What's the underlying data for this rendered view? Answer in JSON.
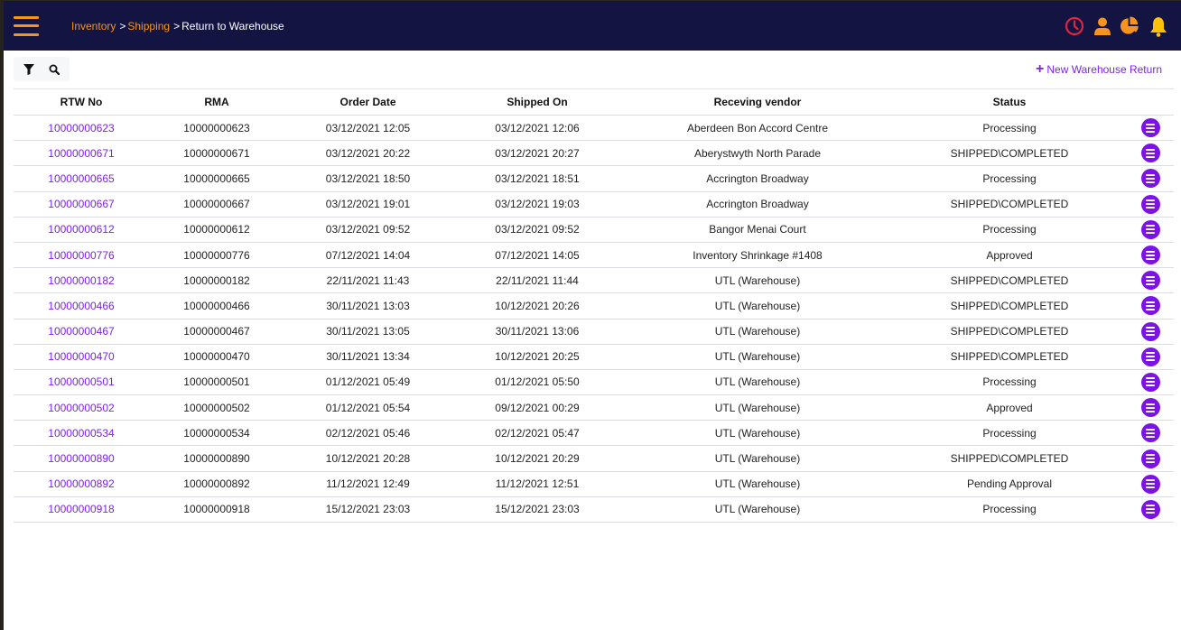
{
  "header": {
    "breadcrumb": [
      {
        "label": "Inventory",
        "link": true
      },
      {
        "label": "Shipping",
        "link": true
      },
      {
        "label": "Return to Warehouse",
        "link": false
      }
    ],
    "separator": ">",
    "icons": [
      "clock-icon",
      "user-icon",
      "pie-chart-icon",
      "bell-icon"
    ],
    "colors": {
      "bar": "#141443",
      "accent": "#f7941d",
      "clock": "#e0263c",
      "bell": "#ffc107"
    }
  },
  "toolbar": {
    "filter_icon": "filter-icon",
    "search_icon": "search-icon",
    "new_button_label": "New Warehouse Return"
  },
  "table": {
    "columns": [
      "RTW No",
      "RMA",
      "Order Date",
      "Shipped On",
      "Receving vendor",
      "Status",
      ""
    ],
    "rows": [
      {
        "rtw": "10000000623",
        "rma": "10000000623",
        "order_date": "03/12/2021 12:05",
        "shipped_on": "03/12/2021 12:06",
        "vendor": "Aberdeen Bon Accord Centre",
        "status": "Processing"
      },
      {
        "rtw": "10000000671",
        "rma": "10000000671",
        "order_date": "03/12/2021 20:22",
        "shipped_on": "03/12/2021 20:27",
        "vendor": "Aberystwyth North Parade",
        "status": "SHIPPED\\COMPLETED"
      },
      {
        "rtw": "10000000665",
        "rma": "10000000665",
        "order_date": "03/12/2021 18:50",
        "shipped_on": "03/12/2021 18:51",
        "vendor": "Accrington Broadway",
        "status": "Processing"
      },
      {
        "rtw": "10000000667",
        "rma": "10000000667",
        "order_date": "03/12/2021 19:01",
        "shipped_on": "03/12/2021 19:03",
        "vendor": "Accrington Broadway",
        "status": "SHIPPED\\COMPLETED"
      },
      {
        "rtw": "10000000612",
        "rma": "10000000612",
        "order_date": "03/12/2021 09:52",
        "shipped_on": "03/12/2021 09:52",
        "vendor": "Bangor Menai Court",
        "status": "Processing"
      },
      {
        "rtw": "10000000776",
        "rma": "10000000776",
        "order_date": "07/12/2021 14:04",
        "shipped_on": "07/12/2021 14:05",
        "vendor": "Inventory Shrinkage #1408",
        "status": "Approved"
      },
      {
        "rtw": "10000000182",
        "rma": "10000000182",
        "order_date": "22/11/2021 11:43",
        "shipped_on": "22/11/2021 11:44",
        "vendor": "UTL (Warehouse)",
        "status": "SHIPPED\\COMPLETED"
      },
      {
        "rtw": "10000000466",
        "rma": "10000000466",
        "order_date": "30/11/2021 13:03",
        "shipped_on": "10/12/2021 20:26",
        "vendor": "UTL (Warehouse)",
        "status": "SHIPPED\\COMPLETED"
      },
      {
        "rtw": "10000000467",
        "rma": "10000000467",
        "order_date": "30/11/2021 13:05",
        "shipped_on": "30/11/2021 13:06",
        "vendor": "UTL (Warehouse)",
        "status": "SHIPPED\\COMPLETED"
      },
      {
        "rtw": "10000000470",
        "rma": "10000000470",
        "order_date": "30/11/2021 13:34",
        "shipped_on": "10/12/2021 20:25",
        "vendor": "UTL (Warehouse)",
        "status": "SHIPPED\\COMPLETED"
      },
      {
        "rtw": "10000000501",
        "rma": "10000000501",
        "order_date": "01/12/2021 05:49",
        "shipped_on": "01/12/2021 05:50",
        "vendor": "UTL (Warehouse)",
        "status": "Processing"
      },
      {
        "rtw": "10000000502",
        "rma": "10000000502",
        "order_date": "01/12/2021 05:54",
        "shipped_on": "09/12/2021 00:29",
        "vendor": "UTL (Warehouse)",
        "status": "Approved"
      },
      {
        "rtw": "10000000534",
        "rma": "10000000534",
        "order_date": "02/12/2021 05:46",
        "shipped_on": "02/12/2021 05:47",
        "vendor": "UTL (Warehouse)",
        "status": "Processing"
      },
      {
        "rtw": "10000000890",
        "rma": "10000000890",
        "order_date": "10/12/2021 20:28",
        "shipped_on": "10/12/2021 20:29",
        "vendor": "UTL (Warehouse)",
        "status": "SHIPPED\\COMPLETED"
      },
      {
        "rtw": "10000000892",
        "rma": "10000000892",
        "order_date": "11/12/2021 12:49",
        "shipped_on": "11/12/2021 12:51",
        "vendor": "UTL (Warehouse)",
        "status": "Pending Approval"
      },
      {
        "rtw": "10000000918",
        "rma": "10000000918",
        "order_date": "15/12/2021 23:03",
        "shipped_on": "15/12/2021 23:03",
        "vendor": "UTL (Warehouse)",
        "status": "Processing"
      }
    ],
    "row_action_icon": "row-menu-icon",
    "colors": {
      "link": "#7d22e6",
      "action": "#7b12e6"
    }
  }
}
